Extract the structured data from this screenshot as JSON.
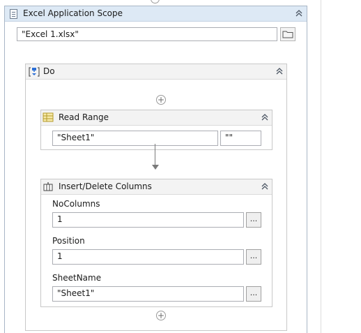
{
  "scope": {
    "title": "Excel Application Scope",
    "file_path": "\"Excel 1.xlsx\""
  },
  "do_sequence": {
    "title": "Do"
  },
  "read_range": {
    "title": "Read Range",
    "sheet": "\"Sheet1\"",
    "range": "\"\""
  },
  "insert_delete_columns": {
    "title": "Insert/Delete Columns",
    "no_columns_label": "NoColumns",
    "no_columns_value": "1",
    "position_label": "Position",
    "position_value": "1",
    "sheet_name_label": "SheetName",
    "sheet_name_value": "\"Sheet1\"",
    "browse_label": "..."
  },
  "icons": {
    "collapse": "double-chevron-up-icon",
    "add": "plus-circle-icon",
    "folder": "folder-icon"
  }
}
